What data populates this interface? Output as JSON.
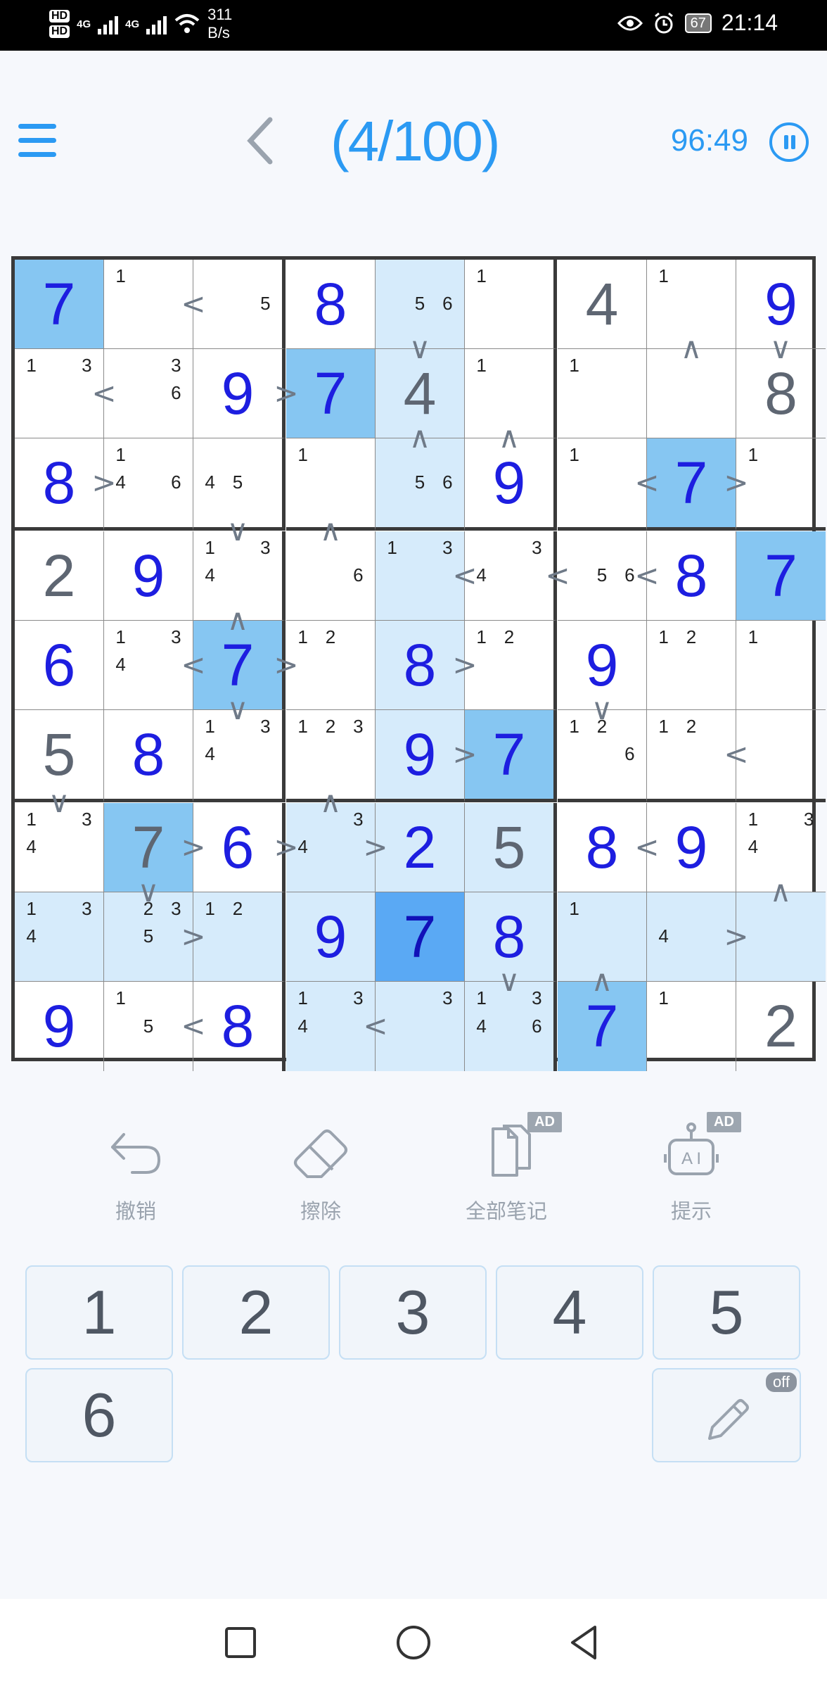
{
  "status_bar": {
    "hd1": "HD",
    "hd2": "HD",
    "net1": "4G",
    "net2": "4G",
    "speed_value": "311",
    "speed_unit": "B/s",
    "battery": "67",
    "time": "21:14"
  },
  "header": {
    "level": "(4/100)",
    "timer": "96:49"
  },
  "board": {
    "cells": [
      [
        {
          "v": "7",
          "t": "user",
          "bg": "sel"
        },
        {
          "n": [
            "1",
            "",
            ""
          ]
        },
        {
          "n": [
            "",
            "",
            "",
            "",
            " ",
            "5"
          ]
        },
        {
          "v": "8",
          "t": "user"
        },
        {
          "n": [
            "",
            "",
            "",
            "",
            "5",
            "6"
          ],
          "bg": "hl"
        },
        {
          "n": [
            "1"
          ]
        },
        {
          "v": "4",
          "t": "given"
        },
        {
          "n": [
            "1"
          ]
        },
        {
          "v": "9",
          "t": "user"
        }
      ],
      [
        {
          "n": [
            "1",
            "",
            "3"
          ]
        },
        {
          "n": [
            "",
            "",
            "3",
            "",
            "",
            "6"
          ]
        },
        {
          "v": "9",
          "t": "user"
        },
        {
          "v": "7",
          "t": "user",
          "bg": "sel"
        },
        {
          "v": "4",
          "t": "given",
          "bg": "hl"
        },
        {
          "n": [
            "1"
          ]
        },
        {
          "n": [
            "1"
          ]
        },
        {},
        {
          "v": "8",
          "t": "given"
        }
      ],
      [
        {
          "v": "8",
          "t": "user"
        },
        {
          "n": [
            "1",
            "",
            "",
            "4",
            "",
            "6"
          ]
        },
        {
          "n": [
            "",
            "",
            "",
            "4",
            "5",
            ""
          ]
        },
        {
          "n": [
            "1"
          ]
        },
        {
          "n": [
            "",
            "",
            "",
            "",
            "5",
            "6"
          ],
          "bg": "hl"
        },
        {
          "v": "9",
          "t": "user"
        },
        {
          "n": [
            "1"
          ]
        },
        {
          "v": "7",
          "t": "user",
          "bg": "sel"
        },
        {
          "n": [
            "1"
          ]
        }
      ],
      [
        {
          "v": "2",
          "t": "given"
        },
        {
          "v": "9",
          "t": "user"
        },
        {
          "n": [
            "1",
            "",
            "3",
            "4",
            "",
            ""
          ]
        },
        {
          "n": [
            "",
            "",
            "",
            "",
            "",
            "6"
          ]
        },
        {
          "n": [
            "1",
            "",
            "3"
          ],
          "bg": "hl"
        },
        {
          "n": [
            "",
            "",
            "3",
            "4",
            "",
            ""
          ]
        },
        {
          "n": [
            "",
            "",
            "",
            "",
            "5",
            "6"
          ]
        },
        {
          "v": "8",
          "t": "user"
        },
        {
          "v": "7",
          "t": "user",
          "bg": "sel"
        }
      ],
      [
        {
          "v": "6",
          "t": "user"
        },
        {
          "n": [
            "1",
            "",
            "3",
            "4",
            "",
            ""
          ]
        },
        {
          "v": "7",
          "t": "user",
          "bg": "sel"
        },
        {
          "n": [
            "1",
            "2",
            ""
          ]
        },
        {
          "v": "8",
          "t": "user",
          "bg": "hl"
        },
        {
          "n": [
            "1",
            "2",
            ""
          ]
        },
        {
          "v": "9",
          "t": "user"
        },
        {
          "n": [
            "1",
            "2",
            ""
          ]
        },
        {
          "n": [
            "1"
          ]
        }
      ],
      [
        {
          "v": "5",
          "t": "given"
        },
        {
          "v": "8",
          "t": "user"
        },
        {
          "n": [
            "1",
            "",
            "3",
            "4",
            "",
            ""
          ]
        },
        {
          "n": [
            "1",
            "2",
            "3"
          ]
        },
        {
          "v": "9",
          "t": "user",
          "bg": "hl"
        },
        {
          "v": "7",
          "t": "user",
          "bg": "sel"
        },
        {
          "n": [
            "1",
            "2",
            "",
            "",
            "",
            "6"
          ]
        },
        {
          "n": [
            "1",
            "2",
            ""
          ]
        },
        {}
      ],
      [
        {
          "n": [
            "1",
            "",
            "3",
            "4",
            "",
            ""
          ]
        },
        {
          "v": "7",
          "t": "given",
          "bg": "sel"
        },
        {
          "v": "6",
          "t": "user"
        },
        {
          "n": [
            "",
            "",
            "3",
            "4",
            "",
            ""
          ],
          "bg": "hl"
        },
        {
          "v": "2",
          "t": "user",
          "bg": "hl"
        },
        {
          "v": "5",
          "t": "given",
          "bg": "hl"
        },
        {
          "v": "8",
          "t": "user"
        },
        {
          "v": "9",
          "t": "user"
        },
        {
          "n": [
            "1",
            "",
            "3",
            "4",
            "",
            ""
          ]
        }
      ],
      [
        {
          "n": [
            "1",
            "",
            "3",
            "4",
            "",
            ""
          ],
          "bg": "hl"
        },
        {
          "n": [
            "",
            "2",
            "3",
            "",
            "5",
            ""
          ],
          "bg": "hl"
        },
        {
          "n": [
            "1",
            "2",
            ""
          ],
          "bg": "hl"
        },
        {
          "v": "9",
          "t": "user",
          "bg": "hl"
        },
        {
          "v": "7",
          "t": "user",
          "bg": "cur"
        },
        {
          "v": "8",
          "t": "user",
          "bg": "hl"
        },
        {
          "n": [
            "1"
          ],
          "bg": "hl"
        },
        {
          "n": [
            "",
            "",
            "",
            "4",
            "",
            ""
          ],
          "bg": "hl"
        },
        {
          "bg": "hl"
        }
      ],
      [
        {
          "v": "9",
          "t": "user"
        },
        {
          "n": [
            "1",
            "",
            "",
            "",
            "5",
            ""
          ]
        },
        {
          "v": "8",
          "t": "user"
        },
        {
          "n": [
            "1",
            "",
            "3",
            "4",
            "",
            ""
          ],
          "bg": "hl"
        },
        {
          "n": [
            "",
            "",
            "3"
          ],
          "bg": "hl"
        },
        {
          "n": [
            "1",
            "",
            "3",
            "4",
            "",
            "6"
          ],
          "bg": "hl"
        },
        {
          "v": "7",
          "t": "user",
          "bg": "sel"
        },
        {
          "n": [
            "1"
          ]
        },
        {
          "v": "2",
          "t": "given"
        }
      ]
    ],
    "inequalities": [
      {
        "s": "<",
        "r": 0,
        "c": 1,
        "d": "h"
      },
      {
        "s": "<",
        "r": 1,
        "c": 0,
        "d": "h"
      },
      {
        "s": ">",
        "r": 1,
        "c": 2,
        "d": "h"
      },
      {
        "s": "v",
        "r": 0,
        "c": 4,
        "d": "v"
      },
      {
        "s": "^",
        "r": 0,
        "c": 7,
        "d": "v"
      },
      {
        "s": "v",
        "r": 0,
        "c": 8,
        "d": "v"
      },
      {
        "s": ">",
        "r": 2,
        "c": 0,
        "d": "h"
      },
      {
        "s": "^",
        "r": 1,
        "c": 4,
        "d": "v"
      },
      {
        "s": "^",
        "r": 1,
        "c": 5,
        "d": "v"
      },
      {
        "s": "<",
        "r": 2,
        "c": 6,
        "d": "h"
      },
      {
        "s": ">",
        "r": 2,
        "c": 7,
        "d": "h"
      },
      {
        "s": "v",
        "r": 2,
        "c": 2,
        "d": "v"
      },
      {
        "s": "^",
        "r": 2,
        "c": 3,
        "d": "v"
      },
      {
        "s": "<",
        "r": 3,
        "c": 4,
        "d": "h"
      },
      {
        "s": "<",
        "r": 3,
        "c": 5,
        "d": "h"
      },
      {
        "s": "<",
        "r": 3,
        "c": 6,
        "d": "h"
      },
      {
        "s": "^",
        "r": 3,
        "c": 2,
        "d": "v"
      },
      {
        "s": "<",
        "r": 4,
        "c": 1,
        "d": "h"
      },
      {
        "s": ">",
        "r": 4,
        "c": 2,
        "d": "h"
      },
      {
        "s": ">",
        "r": 4,
        "c": 4,
        "d": "h"
      },
      {
        "s": "v",
        "r": 4,
        "c": 2,
        "d": "v"
      },
      {
        "s": "v",
        "r": 4,
        "c": 6,
        "d": "v"
      },
      {
        "s": ">",
        "r": 5,
        "c": 4,
        "d": "h"
      },
      {
        "s": "<",
        "r": 5,
        "c": 7,
        "d": "h"
      },
      {
        "s": "v",
        "r": 5,
        "c": 0,
        "d": "v"
      },
      {
        "s": "^",
        "r": 5,
        "c": 3,
        "d": "v"
      },
      {
        "s": ">",
        "r": 6,
        "c": 1,
        "d": "h"
      },
      {
        "s": ">",
        "r": 6,
        "c": 2,
        "d": "h"
      },
      {
        "s": ">",
        "r": 6,
        "c": 3,
        "d": "h"
      },
      {
        "s": "<",
        "r": 6,
        "c": 6,
        "d": "h"
      },
      {
        "s": "v",
        "r": 6,
        "c": 1,
        "d": "v"
      },
      {
        "s": "^",
        "r": 6,
        "c": 8,
        "d": "v"
      },
      {
        "s": ">",
        "r": 7,
        "c": 1,
        "d": "h"
      },
      {
        "s": ">",
        "r": 7,
        "c": 7,
        "d": "h"
      },
      {
        "s": "v",
        "r": 7,
        "c": 5,
        "d": "v"
      },
      {
        "s": "^",
        "r": 7,
        "c": 6,
        "d": "v"
      },
      {
        "s": "<",
        "r": 8,
        "c": 1,
        "d": "h"
      },
      {
        "s": "<",
        "r": 8,
        "c": 3,
        "d": "h"
      }
    ]
  },
  "tools": {
    "undo": "撤销",
    "erase": "擦除",
    "all_notes": "全部笔记",
    "hint": "提示",
    "ad_badge": "AD"
  },
  "keypad": {
    "keys": [
      "1",
      "2",
      "3",
      "4",
      "5",
      "6"
    ],
    "pencil_state": "off"
  },
  "colors": {
    "accent": "#2b9af3",
    "user_digit": "#1d1ee0",
    "given_digit": "#5e6672",
    "highlight": "#d6ebfb",
    "selected": "#86c6f2"
  }
}
